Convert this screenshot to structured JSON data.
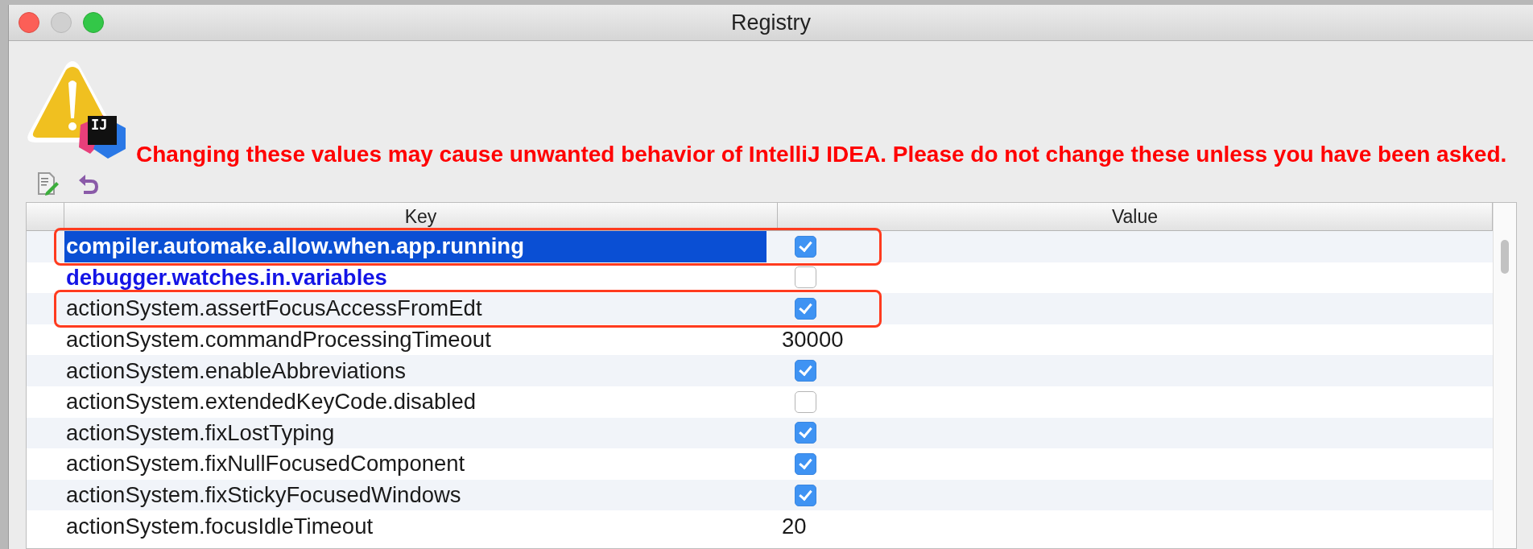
{
  "window": {
    "title": "Registry"
  },
  "logo": "IJ",
  "warning": "Changing these values may cause unwanted behavior of IntelliJ IDEA. Please do not change these unless you have been asked.",
  "table": {
    "columns": [
      "Key",
      "Value"
    ],
    "rows": [
      {
        "key": "compiler.automake.allow.when.app.running",
        "kind": "checkbox",
        "checked": true,
        "modified": true,
        "selected": true,
        "annotated": true
      },
      {
        "key": "debugger.watches.in.variables",
        "kind": "checkbox",
        "checked": false,
        "modified": true,
        "selected": false,
        "annotated": false
      },
      {
        "key": "actionSystem.assertFocusAccessFromEdt",
        "kind": "checkbox",
        "checked": true,
        "modified": false,
        "selected": false,
        "annotated": true
      },
      {
        "key": "actionSystem.commandProcessingTimeout",
        "kind": "text",
        "value": "30000",
        "modified": false,
        "selected": false,
        "annotated": false
      },
      {
        "key": "actionSystem.enableAbbreviations",
        "kind": "checkbox",
        "checked": true,
        "modified": false,
        "selected": false,
        "annotated": false
      },
      {
        "key": "actionSystem.extendedKeyCode.disabled",
        "kind": "checkbox",
        "checked": false,
        "modified": false,
        "selected": false,
        "annotated": false
      },
      {
        "key": "actionSystem.fixLostTyping",
        "kind": "checkbox",
        "checked": true,
        "modified": false,
        "selected": false,
        "annotated": false
      },
      {
        "key": "actionSystem.fixNullFocusedComponent",
        "kind": "checkbox",
        "checked": true,
        "modified": false,
        "selected": false,
        "annotated": false
      },
      {
        "key": "actionSystem.fixStickyFocusedWindows",
        "kind": "checkbox",
        "checked": true,
        "modified": false,
        "selected": false,
        "annotated": false
      },
      {
        "key": "actionSystem.focusIdleTimeout",
        "kind": "text",
        "value": "20",
        "modified": false,
        "selected": false,
        "annotated": false
      }
    ]
  }
}
